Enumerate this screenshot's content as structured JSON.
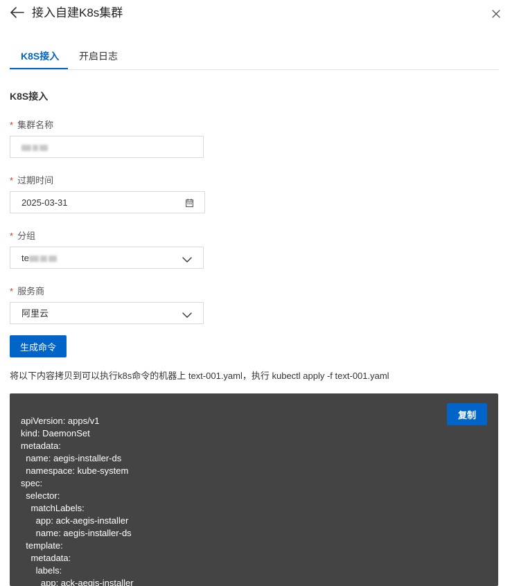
{
  "header": {
    "title": "接入自建K8s集群",
    "back_icon": "arrow-left-icon",
    "close_icon": "close-icon"
  },
  "tabs": [
    {
      "label": "K8S接入",
      "active": true
    },
    {
      "label": "开启日志",
      "active": false
    }
  ],
  "section_title": "K8S接入",
  "form": {
    "cluster_name": {
      "label": "集群名称",
      "required": true,
      "value_visible_prefix": ""
    },
    "expiry": {
      "label": "过期时间",
      "required": true,
      "value": "2025-03-31",
      "icon": "calendar-icon"
    },
    "group": {
      "label": "分组",
      "required": true,
      "value_visible_prefix": "te",
      "icon": "chevron-down-icon"
    },
    "provider": {
      "label": "服务商",
      "required": true,
      "value": "阿里云",
      "icon": "chevron-down-icon"
    }
  },
  "generate_button": "生成命令",
  "instruction": "将以下内容拷贝到可以执行k8s命令的机器上 text-001.yaml，执行 kubectl apply -f text-001.yaml",
  "code": {
    "copy_label": "复制",
    "lines": [
      "apiVersion: apps/v1",
      "kind: DaemonSet",
      "metadata:",
      "  name: aegis-installer-ds",
      "  namespace: kube-system",
      "spec:",
      "  selector:",
      "    matchLabels:",
      "      app: ack-aegis-installer",
      "      name: aegis-installer-ds",
      "  template:",
      "    metadata:",
      "      labels:",
      "        app: ack-aegis-installer"
    ]
  },
  "colors": {
    "primary": "#0064c8",
    "required": "#d93026",
    "code_bg": "#444444"
  }
}
